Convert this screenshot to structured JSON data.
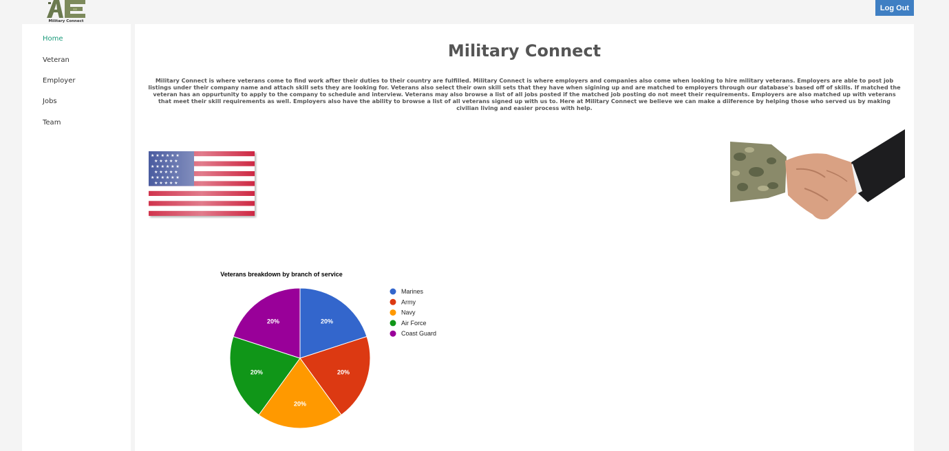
{
  "header": {
    "logo_text": "Military Connect",
    "logout_label": "Log Out"
  },
  "sidebar": {
    "items": [
      {
        "label": "Home",
        "active": true
      },
      {
        "label": "Veteran",
        "active": false
      },
      {
        "label": "Employer",
        "active": false
      },
      {
        "label": "Jobs",
        "active": false
      },
      {
        "label": "Team",
        "active": false
      }
    ]
  },
  "main": {
    "title": "Military Connect",
    "intro": "Military Connect is where veterans come to find work after their duties to their country are fulfilled. Military Connect is where employers and companies also come when looking to hire military veterans. Employers are able to post job listings under their company name and attach skill sets they are looking for. Veterans also select their own skill sets that they have when sigining up and are matched to employers through our database's based off of skills. If matched the veteran has an oppurtunity to apply to the company to schedule and interview. Veterans may also browse a list of all jobs posted if the matched job posting do not meet their requirements. Employers are also matched up with veterans that meet their skill requirements as well. Employers also have the ability to browse a list of all veterans signed up with us to. Here at Military Connect we believe we can make a diiference by helping those who served us by making civilian living and easier process with help."
  },
  "colors": {
    "accent": "#3f7fc3",
    "active_nav": "#1a9a7a"
  },
  "chart_data": {
    "type": "pie",
    "title": "Veterans breakdown by branch of service",
    "legend_position": "right",
    "categories": [
      "Marines",
      "Army",
      "Navy",
      "Air Force",
      "Coast Guard"
    ],
    "values": [
      20,
      20,
      20,
      20,
      20
    ],
    "labels": [
      "20%",
      "20%",
      "20%",
      "20%",
      "20%"
    ],
    "colors": [
      "#3366cc",
      "#dc3912",
      "#ff9900",
      "#109618",
      "#990099"
    ]
  }
}
